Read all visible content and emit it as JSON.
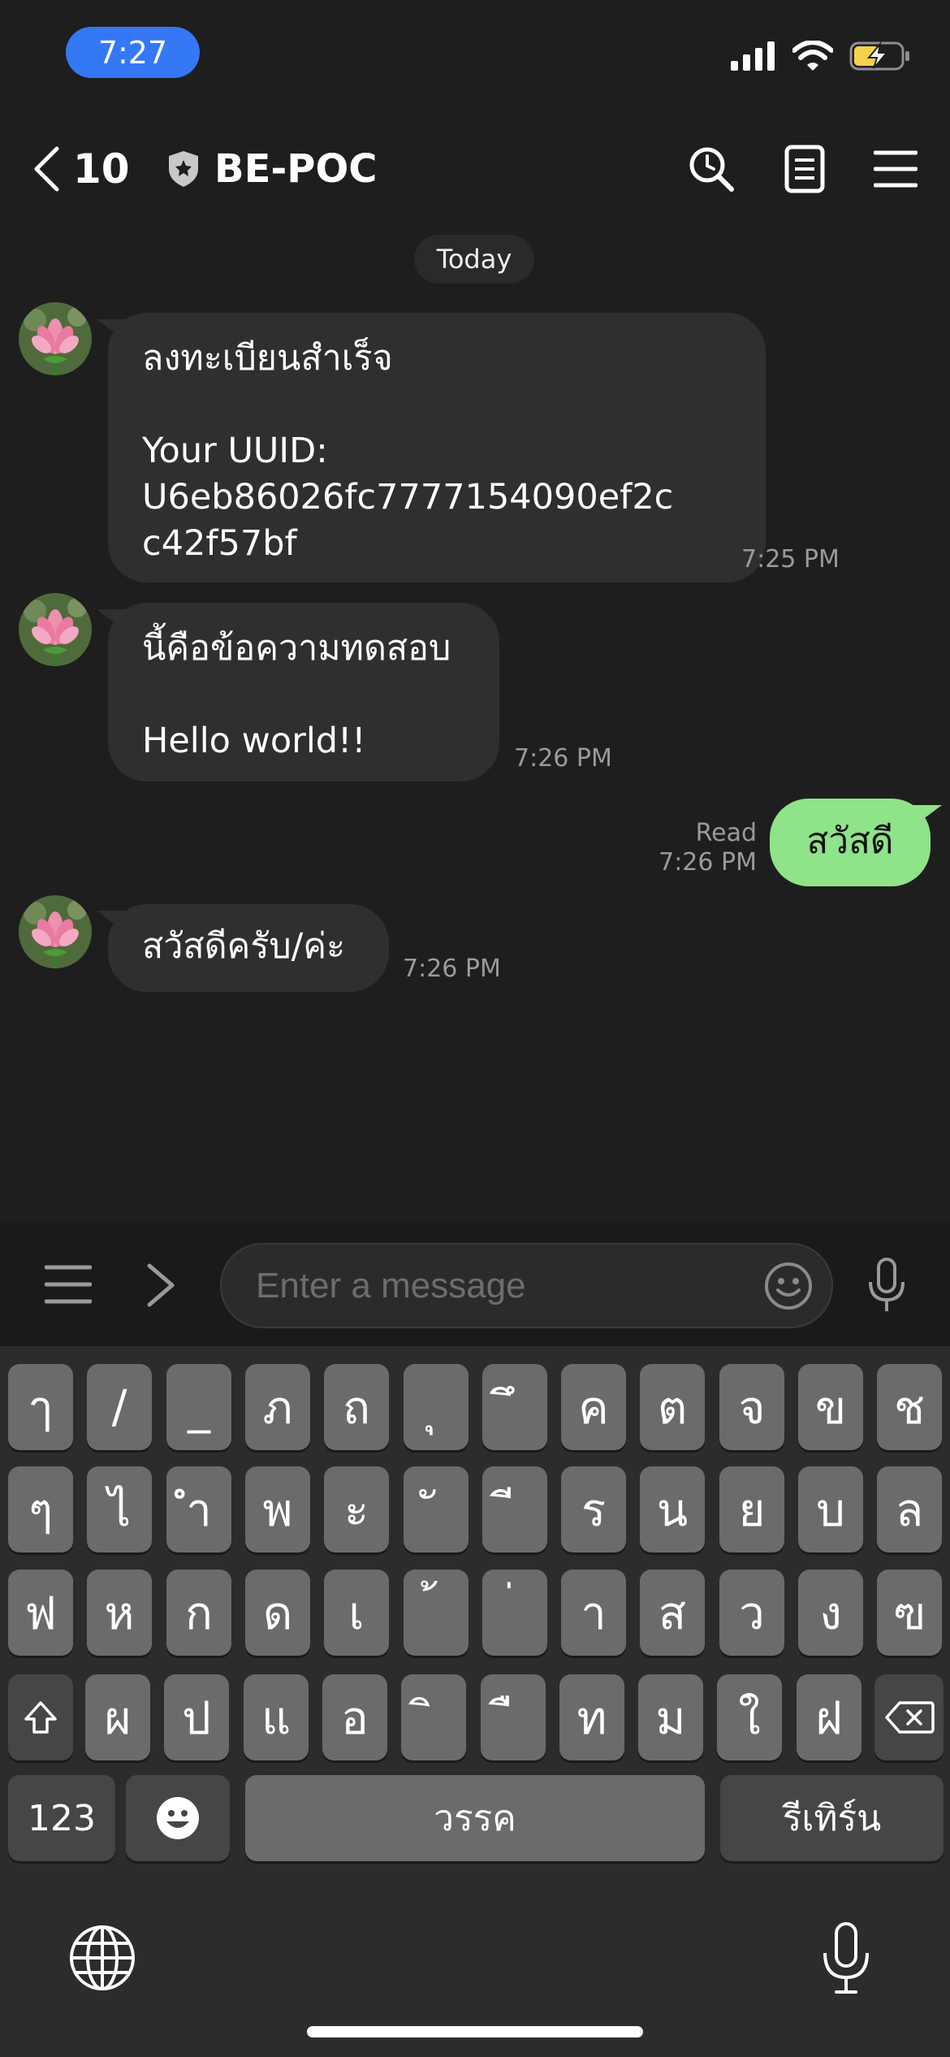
{
  "status": {
    "time": "7:27"
  },
  "header": {
    "back_count": "10",
    "title": "BE-POC"
  },
  "date_divider": "Today",
  "messages": [
    {
      "text": "ลงทะเบียนสำเร็จ\n\nYour UUID:\nU6eb86026fc7777154090ef2c\nc42f57bf",
      "time": "7:25 PM"
    },
    {
      "text": "นี้คือข้อความทดสอบ\n\nHello world!!",
      "time": "7:26 PM"
    },
    {
      "text": "สวัสดี",
      "read": "Read",
      "time": "7:26 PM"
    },
    {
      "text": "สวัสดีครับ/ค่ะ",
      "time": "7:26 PM"
    }
  ],
  "composer": {
    "placeholder": "Enter a message"
  },
  "keyboard": {
    "row1": [
      "ๅ",
      "/",
      "_",
      "ภ",
      "ถ",
      "ุ",
      "ึ",
      "ค",
      "ต",
      "จ",
      "ข",
      "ช"
    ],
    "row2": [
      "ๆ",
      "ไ",
      "ำ",
      "พ",
      "ะ",
      "ั",
      "ี",
      "ร",
      "น",
      "ย",
      "บ",
      "ล"
    ],
    "row3": [
      "ฟ",
      "ห",
      "ก",
      "ด",
      "เ",
      "้",
      "่",
      "า",
      "ส",
      "ว",
      "ง",
      "ฃ"
    ],
    "row4": [
      "ผ",
      "ป",
      "แ",
      "อ",
      "ิ",
      "ื",
      "ท",
      "ม",
      "ใ",
      "ฝ"
    ],
    "numbers_label": "123",
    "space_label": "วรรค",
    "return_label": "รีเทิร์น"
  }
}
